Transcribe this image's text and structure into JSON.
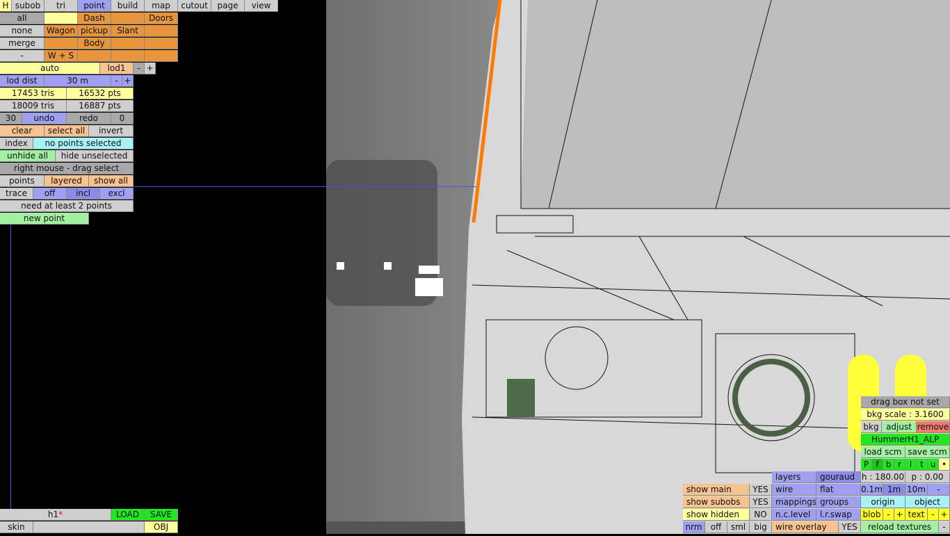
{
  "top_tabs": [
    "H",
    "subob",
    "tri",
    "point",
    "build",
    "map",
    "cutout",
    "page",
    "view"
  ],
  "subob_grid": [
    [
      "all",
      "",
      "Dash",
      "",
      "Doors"
    ],
    [
      "none",
      "Wagon",
      "pickup",
      "Slant",
      ""
    ],
    [
      "merge",
      "",
      "Body",
      "",
      ""
    ],
    [
      "-",
      "W + S",
      "",
      "",
      ""
    ]
  ],
  "lod": {
    "auto": "auto",
    "lod1": "lod1",
    "minus": "-",
    "plus": "+",
    "dist_label": "lod dist",
    "dist_value": "30 m"
  },
  "stats": {
    "tris1": "17453 tris",
    "pts1": "16532 pts",
    "tris2": "18009 tris",
    "pts2": "16887 pts"
  },
  "undo": {
    "count": "30",
    "undo": "undo",
    "redo": "redo",
    "redo_count": "0"
  },
  "select": {
    "clear": "clear",
    "select_all": "select all",
    "invert": "invert",
    "index": "index",
    "status": "no points selected",
    "unhide_all": "unhide all",
    "hide_unselected": "hide unselected",
    "drag_hint": "right mouse - drag select",
    "points": "points",
    "layered": "layered",
    "show_all": "show all",
    "trace": "trace",
    "off": "off",
    "incl": "incl",
    "excl": "excl",
    "need": "need at least 2 points",
    "new_point": "new point"
  },
  "file": {
    "name": "h1",
    "modified": "*",
    "load": "LOAD",
    "save": "SAVE",
    "skin": "skin",
    "obj": "OBJ"
  },
  "bkg": {
    "drag_box": "drag box not set",
    "scale": "bkg scale : 3.1600",
    "bkg": "bkg",
    "adjust": "adjust",
    "remove": "remove",
    "model": "HummerH1_ALP",
    "load_scm": "load scm",
    "save_scm": "save scm",
    "views": [
      "P",
      "f",
      "b",
      "r",
      "l",
      "t",
      "u",
      "•"
    ],
    "h": "h : 180.00",
    "p": "p : 0.00",
    "grid": [
      "0.1m",
      "1m",
      "10m",
      "-"
    ],
    "origin": "origin",
    "object": "object",
    "blob": "blob",
    "text": "text",
    "minus": "-",
    "plus": "+",
    "reload": "reload textures"
  },
  "display": {
    "layers": "layers",
    "gouraud": "gouraud",
    "wire": "wire",
    "flat": "flat",
    "mappings": "mappings",
    "groups": "groups",
    "nclevel": "n.c.level",
    "lrswap": "l.r.swap",
    "wire_overlay": "wire overlay",
    "wire_overlay_val": "YES"
  },
  "show": {
    "main": "show main",
    "main_val": "YES",
    "subobs": "show subobs",
    "subobs_val": "YES",
    "hidden": "show hidden",
    "hidden_val": "NO",
    "sizes": [
      "nrm",
      "off",
      "sml",
      "big"
    ]
  }
}
